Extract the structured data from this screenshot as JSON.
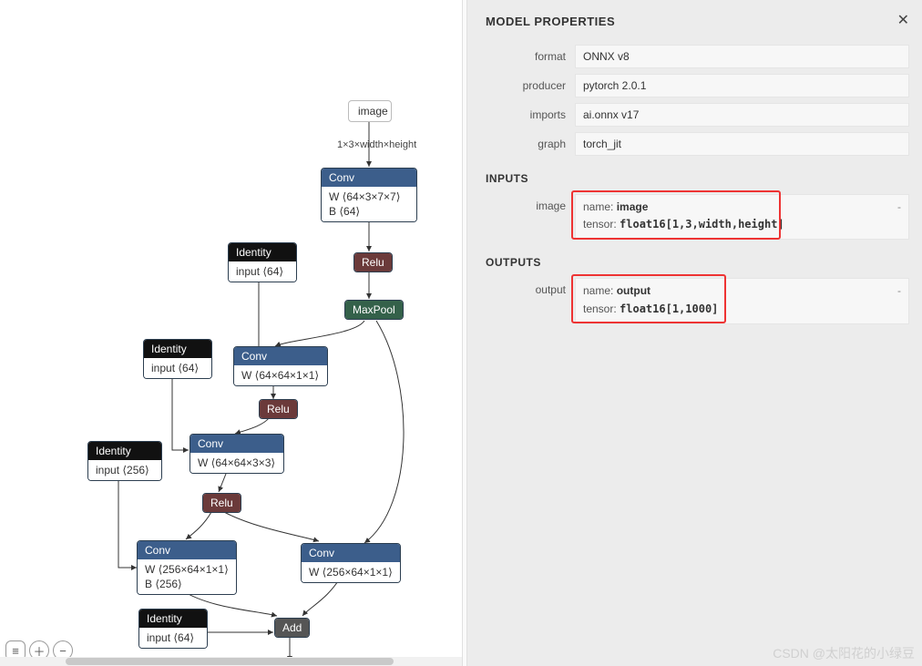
{
  "graph": {
    "input_node_label": "image",
    "input_edge_label": "1×3×width×height",
    "nodes": {
      "conv1": {
        "title": "Conv",
        "W": "W ⟨64×3×7×7⟩",
        "B": "B ⟨64⟩"
      },
      "relu1": {
        "title": "Relu"
      },
      "maxpool": {
        "title": "MaxPool"
      },
      "id1": {
        "title": "Identity",
        "body": "input ⟨64⟩"
      },
      "conv2": {
        "title": "Conv",
        "W": "W ⟨64×64×1×1⟩"
      },
      "id2": {
        "title": "Identity",
        "body": "input ⟨64⟩"
      },
      "relu2": {
        "title": "Relu"
      },
      "conv3": {
        "title": "Conv",
        "W": "W ⟨64×64×3×3⟩"
      },
      "id3": {
        "title": "Identity",
        "body": "input ⟨256⟩"
      },
      "relu3": {
        "title": "Relu"
      },
      "conv4": {
        "title": "Conv",
        "W": "W ⟨256×64×1×1⟩",
        "B": "B ⟨256⟩"
      },
      "conv5": {
        "title": "Conv",
        "W": "W ⟨256×64×1×1⟩"
      },
      "id4": {
        "title": "Identity",
        "body": "input ⟨64⟩"
      },
      "add": {
        "title": "Add"
      }
    }
  },
  "toolbar": {
    "menu_title": "menu",
    "zoom_in_title": "zoom in",
    "zoom_out_title": "zoom out"
  },
  "watermark": "CSDN @太阳花的小绿豆",
  "props": {
    "title": "MODEL PROPERTIES",
    "fields": {
      "format_label": "format",
      "format_value": "ONNX v8",
      "producer_label": "producer",
      "producer_value": "pytorch 2.0.1",
      "imports_label": "imports",
      "imports_value": "ai.onnx v17",
      "graph_label": "graph",
      "graph_value": "torch_jit"
    },
    "inputs_header": "INPUTS",
    "inputs": {
      "image_label": "image",
      "image_name_key": "name:",
      "image_name_val": "image",
      "image_tensor_key": "tensor:",
      "image_tensor_val": "float16[1,3,width,height]"
    },
    "outputs_header": "OUTPUTS",
    "outputs": {
      "output_label": "output",
      "output_name_key": "name:",
      "output_name_val": "output",
      "output_tensor_key": "tensor:",
      "output_tensor_val": "float16[1,1000]"
    }
  }
}
